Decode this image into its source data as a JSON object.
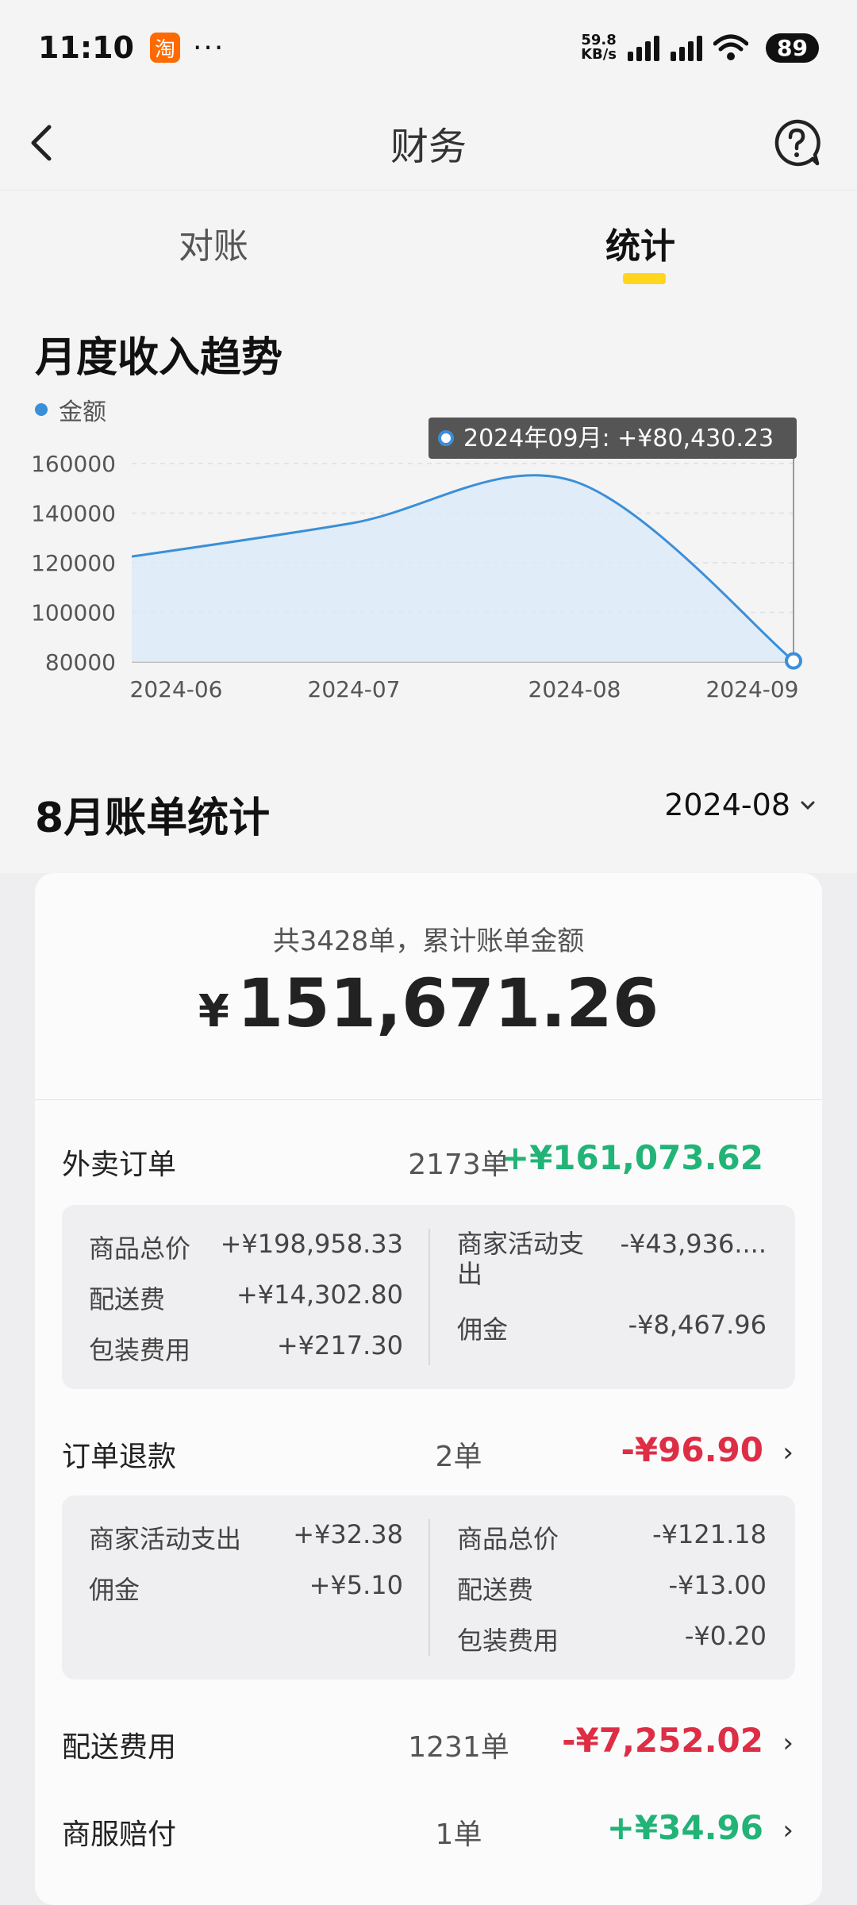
{
  "status_bar": {
    "time": "11:10",
    "app_badge": "淘",
    "more": "···",
    "net_speed_value": "59.8",
    "net_speed_unit": "KB/s",
    "battery": "89"
  },
  "nav": {
    "title": "财务"
  },
  "tabs": [
    {
      "label": "对账",
      "active": false
    },
    {
      "label": "统计",
      "active": true
    }
  ],
  "trend": {
    "title": "月度收入趋势",
    "legend": "金额",
    "tooltip": "2024年09月: +¥80,430.23"
  },
  "chart_data": {
    "type": "area",
    "title": "月度收入趋势",
    "x": [
      "2024-06",
      "2024-07",
      "2024-08",
      "2024-09"
    ],
    "series": [
      {
        "name": "金额",
        "values": [
          122500,
          136000,
          153000,
          80430.23
        ]
      }
    ],
    "yticks": [
      160000,
      140000,
      120000,
      100000,
      80000
    ],
    "ylim": [
      80000,
      160000
    ],
    "grid": true,
    "legend_position": "top-left",
    "colors": {
      "line": "#3b8fd8",
      "fill": "#d9e9f8"
    }
  },
  "monthly": {
    "title": "8月账单统计",
    "month": "2024-08",
    "caption": "共3428单，累计账单金额",
    "currency": "¥",
    "total": "151,671.26"
  },
  "rows": {
    "takeout": {
      "label": "外卖订单",
      "count": "2173单",
      "amount": "+¥161,073.62"
    },
    "refund": {
      "label": "订单退款",
      "count": "2单",
      "amount": "-¥96.90"
    },
    "delivery": {
      "label": "配送费用",
      "count": "1231单",
      "amount": "-¥7,252.02"
    },
    "compensation": {
      "label": "商服赔付",
      "count": "1单",
      "amount": "+¥34.96"
    }
  },
  "takeout_details": {
    "left": [
      {
        "label": "商品总价",
        "value": "+¥198,958.33"
      },
      {
        "label": "配送费",
        "value": "+¥14,302.80"
      },
      {
        "label": "包装费用",
        "value": "+¥217.30"
      }
    ],
    "right": [
      {
        "label": "商家活动支出",
        "value": "-¥43,936...."
      },
      {
        "label": "佣金",
        "value": "-¥8,467.96"
      }
    ]
  },
  "refund_details": {
    "left": [
      {
        "label": "商家活动支出",
        "value": "+¥32.38"
      },
      {
        "label": "佣金",
        "value": "+¥5.10"
      }
    ],
    "right": [
      {
        "label": "商品总价",
        "value": "-¥121.18"
      },
      {
        "label": "配送费",
        "value": "-¥13.00"
      },
      {
        "label": "包装费用",
        "value": "-¥0.20"
      }
    ]
  },
  "colors": {
    "accent_yellow": "#ffd51e",
    "positive": "#22b377",
    "negative": "#dd2e45",
    "chart_line": "#3b8fd8"
  }
}
